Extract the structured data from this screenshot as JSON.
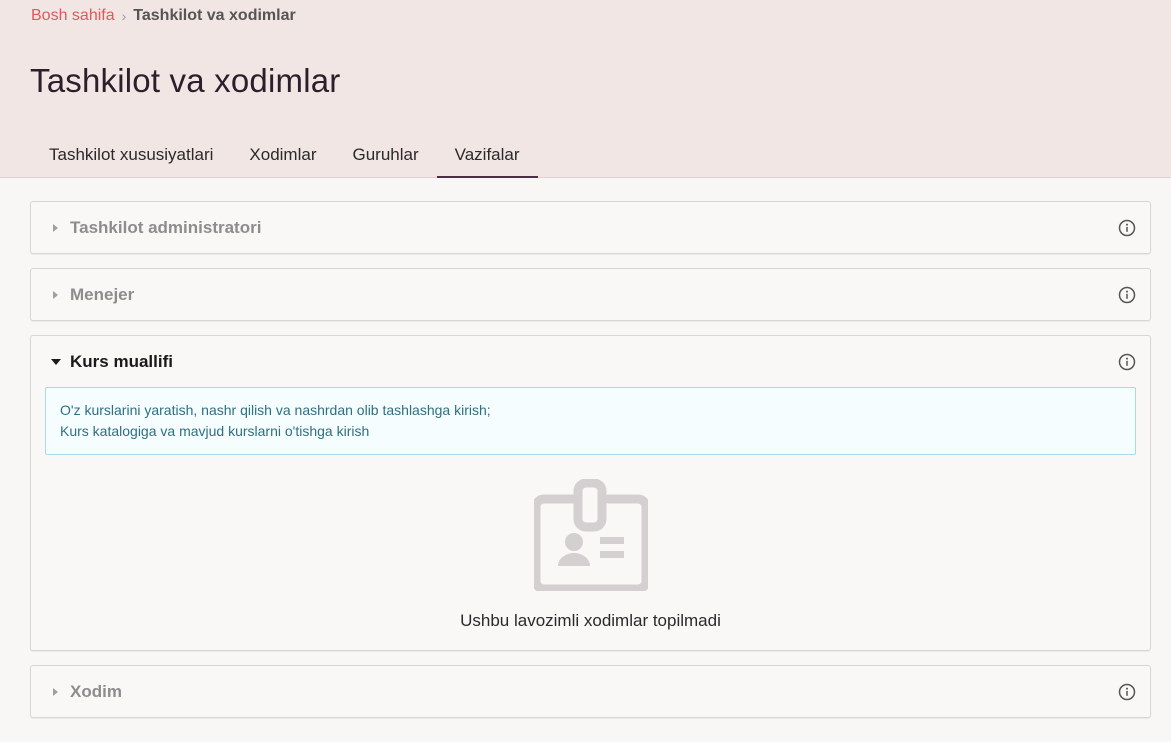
{
  "breadcrumb": {
    "home": "Bosh sahifa",
    "separator": "›",
    "current": "Tashkilot va xodimlar"
  },
  "page": {
    "title": "Tashkilot va xodimlar"
  },
  "tabs": [
    {
      "label": "Tashkilot xususiyatlari",
      "active": false
    },
    {
      "label": "Xodimlar",
      "active": false
    },
    {
      "label": "Guruhlar",
      "active": false
    },
    {
      "label": "Vazifalar",
      "active": true
    }
  ],
  "roles": [
    {
      "title": "Tashkilot administratori",
      "expanded": false
    },
    {
      "title": "Menejer",
      "expanded": false
    },
    {
      "title": "Kurs muallifi",
      "expanded": true,
      "description": [
        "O'z kurslarini yaratish, nashr qilish va nashrdan olib tashlashga kirish;",
        "Kurs katalogiga va mavjud kurslarni o'tishga kirish"
      ],
      "empty_icon": "id-badge-icon",
      "empty_text": "Ushbu lavozimli xodimlar topilmadi"
    },
    {
      "title": "Xodim",
      "expanded": false
    }
  ],
  "colors": {
    "header_bg": "#f1e6e4",
    "breadcrumb_link": "#e0595c",
    "active_tab_underline": "#4a2f42",
    "info_box_border": "#a7dce4",
    "info_box_text": "#2f6f82",
    "empty_icon": "#d4cfd1"
  }
}
